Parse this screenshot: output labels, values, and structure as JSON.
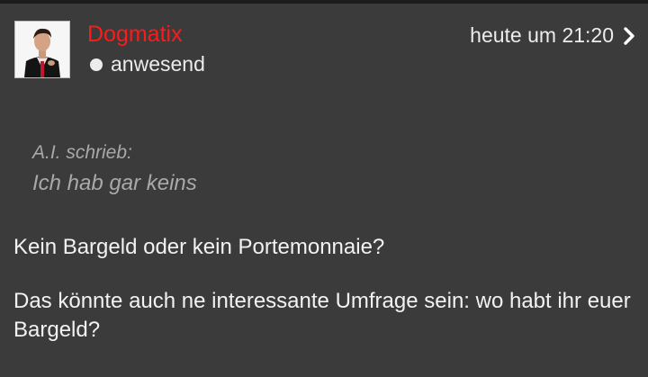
{
  "colors": {
    "background": "#3b3b3b",
    "username": "#ff1a1a",
    "quote_text": "#a9a9a9",
    "body_text": "#f2f2f2"
  },
  "post": {
    "author": {
      "name": "Dogmatix",
      "status": "anwesend",
      "avatar_icon": "user-avatar-photo"
    },
    "timestamp": "heute um 21:20",
    "quote": {
      "author_line": "A.I. schrieb:",
      "text": "Ich hab gar keins"
    },
    "paragraphs": [
      "Kein Bargeld oder kein Portemonnaie?",
      "Das könnte auch ne interessante Umfrage sein: wo habt ihr euer Bargeld?"
    ]
  }
}
